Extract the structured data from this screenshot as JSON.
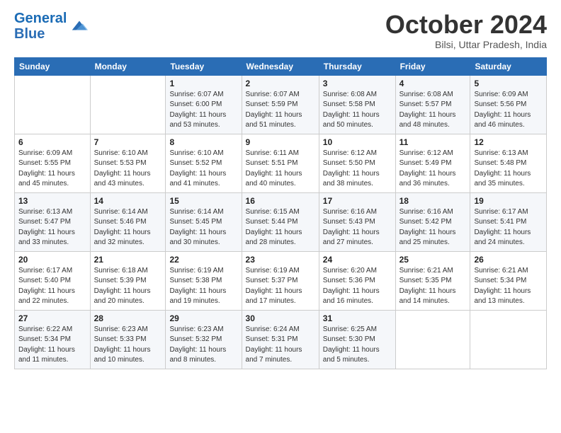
{
  "logo": {
    "line1": "General",
    "line2": "Blue"
  },
  "title": "October 2024",
  "subtitle": "Bilsi, Uttar Pradesh, India",
  "days_of_week": [
    "Sunday",
    "Monday",
    "Tuesday",
    "Wednesday",
    "Thursday",
    "Friday",
    "Saturday"
  ],
  "weeks": [
    [
      {
        "day": "",
        "sunrise": "",
        "sunset": "",
        "daylight": ""
      },
      {
        "day": "",
        "sunrise": "",
        "sunset": "",
        "daylight": ""
      },
      {
        "day": "1",
        "sunrise": "Sunrise: 6:07 AM",
        "sunset": "Sunset: 6:00 PM",
        "daylight": "Daylight: 11 hours and 53 minutes."
      },
      {
        "day": "2",
        "sunrise": "Sunrise: 6:07 AM",
        "sunset": "Sunset: 5:59 PM",
        "daylight": "Daylight: 11 hours and 51 minutes."
      },
      {
        "day": "3",
        "sunrise": "Sunrise: 6:08 AM",
        "sunset": "Sunset: 5:58 PM",
        "daylight": "Daylight: 11 hours and 50 minutes."
      },
      {
        "day": "4",
        "sunrise": "Sunrise: 6:08 AM",
        "sunset": "Sunset: 5:57 PM",
        "daylight": "Daylight: 11 hours and 48 minutes."
      },
      {
        "day": "5",
        "sunrise": "Sunrise: 6:09 AM",
        "sunset": "Sunset: 5:56 PM",
        "daylight": "Daylight: 11 hours and 46 minutes."
      }
    ],
    [
      {
        "day": "6",
        "sunrise": "Sunrise: 6:09 AM",
        "sunset": "Sunset: 5:55 PM",
        "daylight": "Daylight: 11 hours and 45 minutes."
      },
      {
        "day": "7",
        "sunrise": "Sunrise: 6:10 AM",
        "sunset": "Sunset: 5:53 PM",
        "daylight": "Daylight: 11 hours and 43 minutes."
      },
      {
        "day": "8",
        "sunrise": "Sunrise: 6:10 AM",
        "sunset": "Sunset: 5:52 PM",
        "daylight": "Daylight: 11 hours and 41 minutes."
      },
      {
        "day": "9",
        "sunrise": "Sunrise: 6:11 AM",
        "sunset": "Sunset: 5:51 PM",
        "daylight": "Daylight: 11 hours and 40 minutes."
      },
      {
        "day": "10",
        "sunrise": "Sunrise: 6:12 AM",
        "sunset": "Sunset: 5:50 PM",
        "daylight": "Daylight: 11 hours and 38 minutes."
      },
      {
        "day": "11",
        "sunrise": "Sunrise: 6:12 AM",
        "sunset": "Sunset: 5:49 PM",
        "daylight": "Daylight: 11 hours and 36 minutes."
      },
      {
        "day": "12",
        "sunrise": "Sunrise: 6:13 AM",
        "sunset": "Sunset: 5:48 PM",
        "daylight": "Daylight: 11 hours and 35 minutes."
      }
    ],
    [
      {
        "day": "13",
        "sunrise": "Sunrise: 6:13 AM",
        "sunset": "Sunset: 5:47 PM",
        "daylight": "Daylight: 11 hours and 33 minutes."
      },
      {
        "day": "14",
        "sunrise": "Sunrise: 6:14 AM",
        "sunset": "Sunset: 5:46 PM",
        "daylight": "Daylight: 11 hours and 32 minutes."
      },
      {
        "day": "15",
        "sunrise": "Sunrise: 6:14 AM",
        "sunset": "Sunset: 5:45 PM",
        "daylight": "Daylight: 11 hours and 30 minutes."
      },
      {
        "day": "16",
        "sunrise": "Sunrise: 6:15 AM",
        "sunset": "Sunset: 5:44 PM",
        "daylight": "Daylight: 11 hours and 28 minutes."
      },
      {
        "day": "17",
        "sunrise": "Sunrise: 6:16 AM",
        "sunset": "Sunset: 5:43 PM",
        "daylight": "Daylight: 11 hours and 27 minutes."
      },
      {
        "day": "18",
        "sunrise": "Sunrise: 6:16 AM",
        "sunset": "Sunset: 5:42 PM",
        "daylight": "Daylight: 11 hours and 25 minutes."
      },
      {
        "day": "19",
        "sunrise": "Sunrise: 6:17 AM",
        "sunset": "Sunset: 5:41 PM",
        "daylight": "Daylight: 11 hours and 24 minutes."
      }
    ],
    [
      {
        "day": "20",
        "sunrise": "Sunrise: 6:17 AM",
        "sunset": "Sunset: 5:40 PM",
        "daylight": "Daylight: 11 hours and 22 minutes."
      },
      {
        "day": "21",
        "sunrise": "Sunrise: 6:18 AM",
        "sunset": "Sunset: 5:39 PM",
        "daylight": "Daylight: 11 hours and 20 minutes."
      },
      {
        "day": "22",
        "sunrise": "Sunrise: 6:19 AM",
        "sunset": "Sunset: 5:38 PM",
        "daylight": "Daylight: 11 hours and 19 minutes."
      },
      {
        "day": "23",
        "sunrise": "Sunrise: 6:19 AM",
        "sunset": "Sunset: 5:37 PM",
        "daylight": "Daylight: 11 hours and 17 minutes."
      },
      {
        "day": "24",
        "sunrise": "Sunrise: 6:20 AM",
        "sunset": "Sunset: 5:36 PM",
        "daylight": "Daylight: 11 hours and 16 minutes."
      },
      {
        "day": "25",
        "sunrise": "Sunrise: 6:21 AM",
        "sunset": "Sunset: 5:35 PM",
        "daylight": "Daylight: 11 hours and 14 minutes."
      },
      {
        "day": "26",
        "sunrise": "Sunrise: 6:21 AM",
        "sunset": "Sunset: 5:34 PM",
        "daylight": "Daylight: 11 hours and 13 minutes."
      }
    ],
    [
      {
        "day": "27",
        "sunrise": "Sunrise: 6:22 AM",
        "sunset": "Sunset: 5:34 PM",
        "daylight": "Daylight: 11 hours and 11 minutes."
      },
      {
        "day": "28",
        "sunrise": "Sunrise: 6:23 AM",
        "sunset": "Sunset: 5:33 PM",
        "daylight": "Daylight: 11 hours and 10 minutes."
      },
      {
        "day": "29",
        "sunrise": "Sunrise: 6:23 AM",
        "sunset": "Sunset: 5:32 PM",
        "daylight": "Daylight: 11 hours and 8 minutes."
      },
      {
        "day": "30",
        "sunrise": "Sunrise: 6:24 AM",
        "sunset": "Sunset: 5:31 PM",
        "daylight": "Daylight: 11 hours and 7 minutes."
      },
      {
        "day": "31",
        "sunrise": "Sunrise: 6:25 AM",
        "sunset": "Sunset: 5:30 PM",
        "daylight": "Daylight: 11 hours and 5 minutes."
      },
      {
        "day": "",
        "sunrise": "",
        "sunset": "",
        "daylight": ""
      },
      {
        "day": "",
        "sunrise": "",
        "sunset": "",
        "daylight": ""
      }
    ]
  ]
}
